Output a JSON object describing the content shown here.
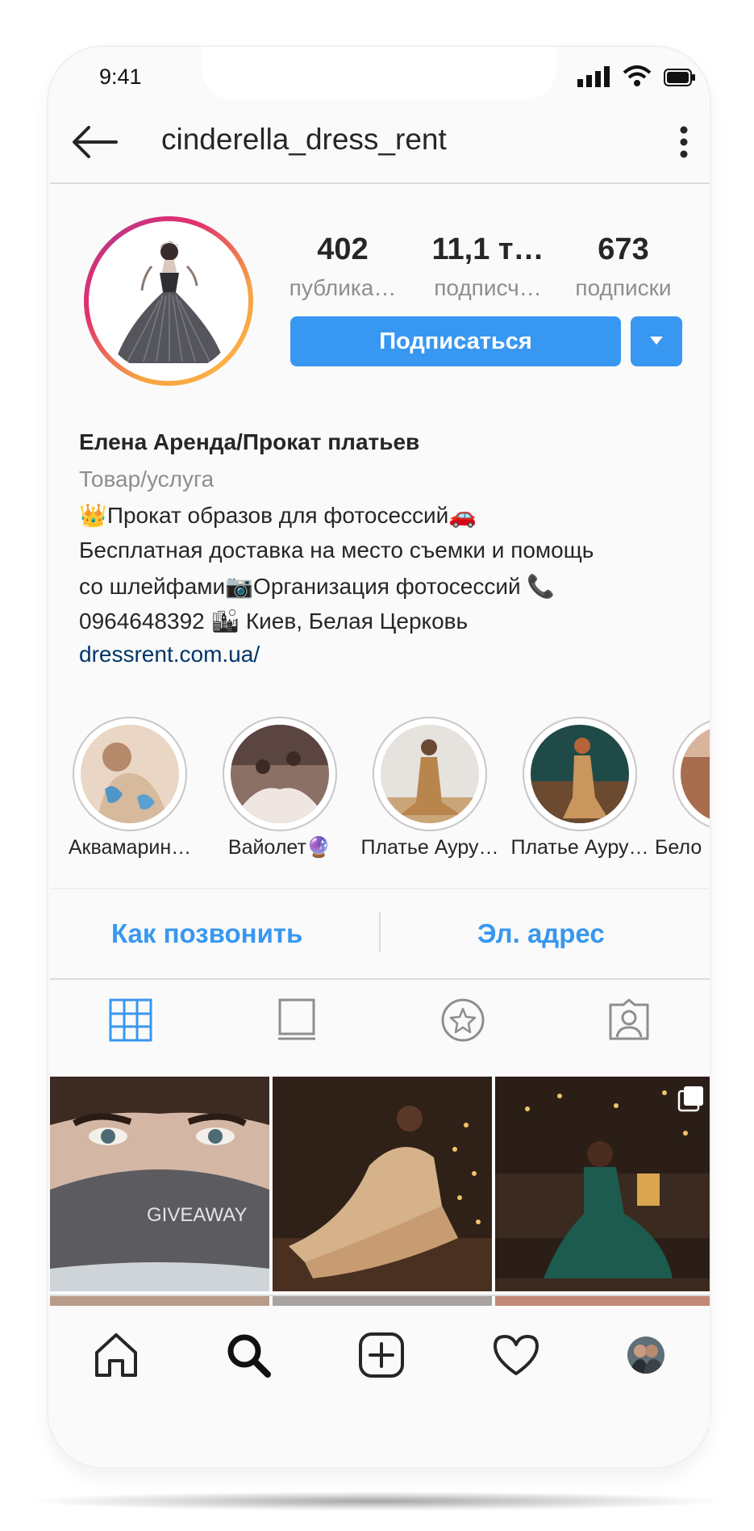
{
  "status_bar": {
    "time": "9:41"
  },
  "header": {
    "username": "cinderella_dress_rent"
  },
  "stats": [
    {
      "value": "402",
      "label": "публика…"
    },
    {
      "value": "11,1 т…",
      "label": "подписч…"
    },
    {
      "value": "673",
      "label": "подписки"
    }
  ],
  "buttons": {
    "follow": "Подписаться"
  },
  "bio": {
    "name": "Елена Аренда/Прокат платьев",
    "category": "Товар/услуга",
    "line1": "👑Прокат образов для фотосессий🚗",
    "line2": "Бесплатная доставка на место съемки и помощь",
    "line3": "со шлейфами📷Организация фотосессий 📞",
    "line4": "0964648392 🏙 Киев, Белая Церковь",
    "link": "dressrent.com.ua/"
  },
  "highlights": [
    {
      "label": "Аквамарин…"
    },
    {
      "label": "Вайолет🔮"
    },
    {
      "label": "Платье Ауру…"
    },
    {
      "label": "Платье Ауру…"
    },
    {
      "label": "Бело"
    }
  ],
  "contacts": {
    "call": "Как позвонить",
    "email": "Эл. адрес"
  },
  "posts": {
    "giveaway_text": "GIVEAWAY"
  },
  "colors": {
    "accent": "#3897f0",
    "link": "#003569",
    "muted": "#8e8e8e"
  },
  "icons": {
    "back": "arrow-left-icon",
    "more": "more-vertical-icon",
    "grid": "grid-icon",
    "feed": "feed-icon",
    "tagged_star": "star-icon",
    "tagged_person": "person-tag-icon",
    "home": "home-icon",
    "search": "search-icon",
    "add": "add-post-icon",
    "likes": "heart-icon",
    "profile": "profile-avatar"
  }
}
